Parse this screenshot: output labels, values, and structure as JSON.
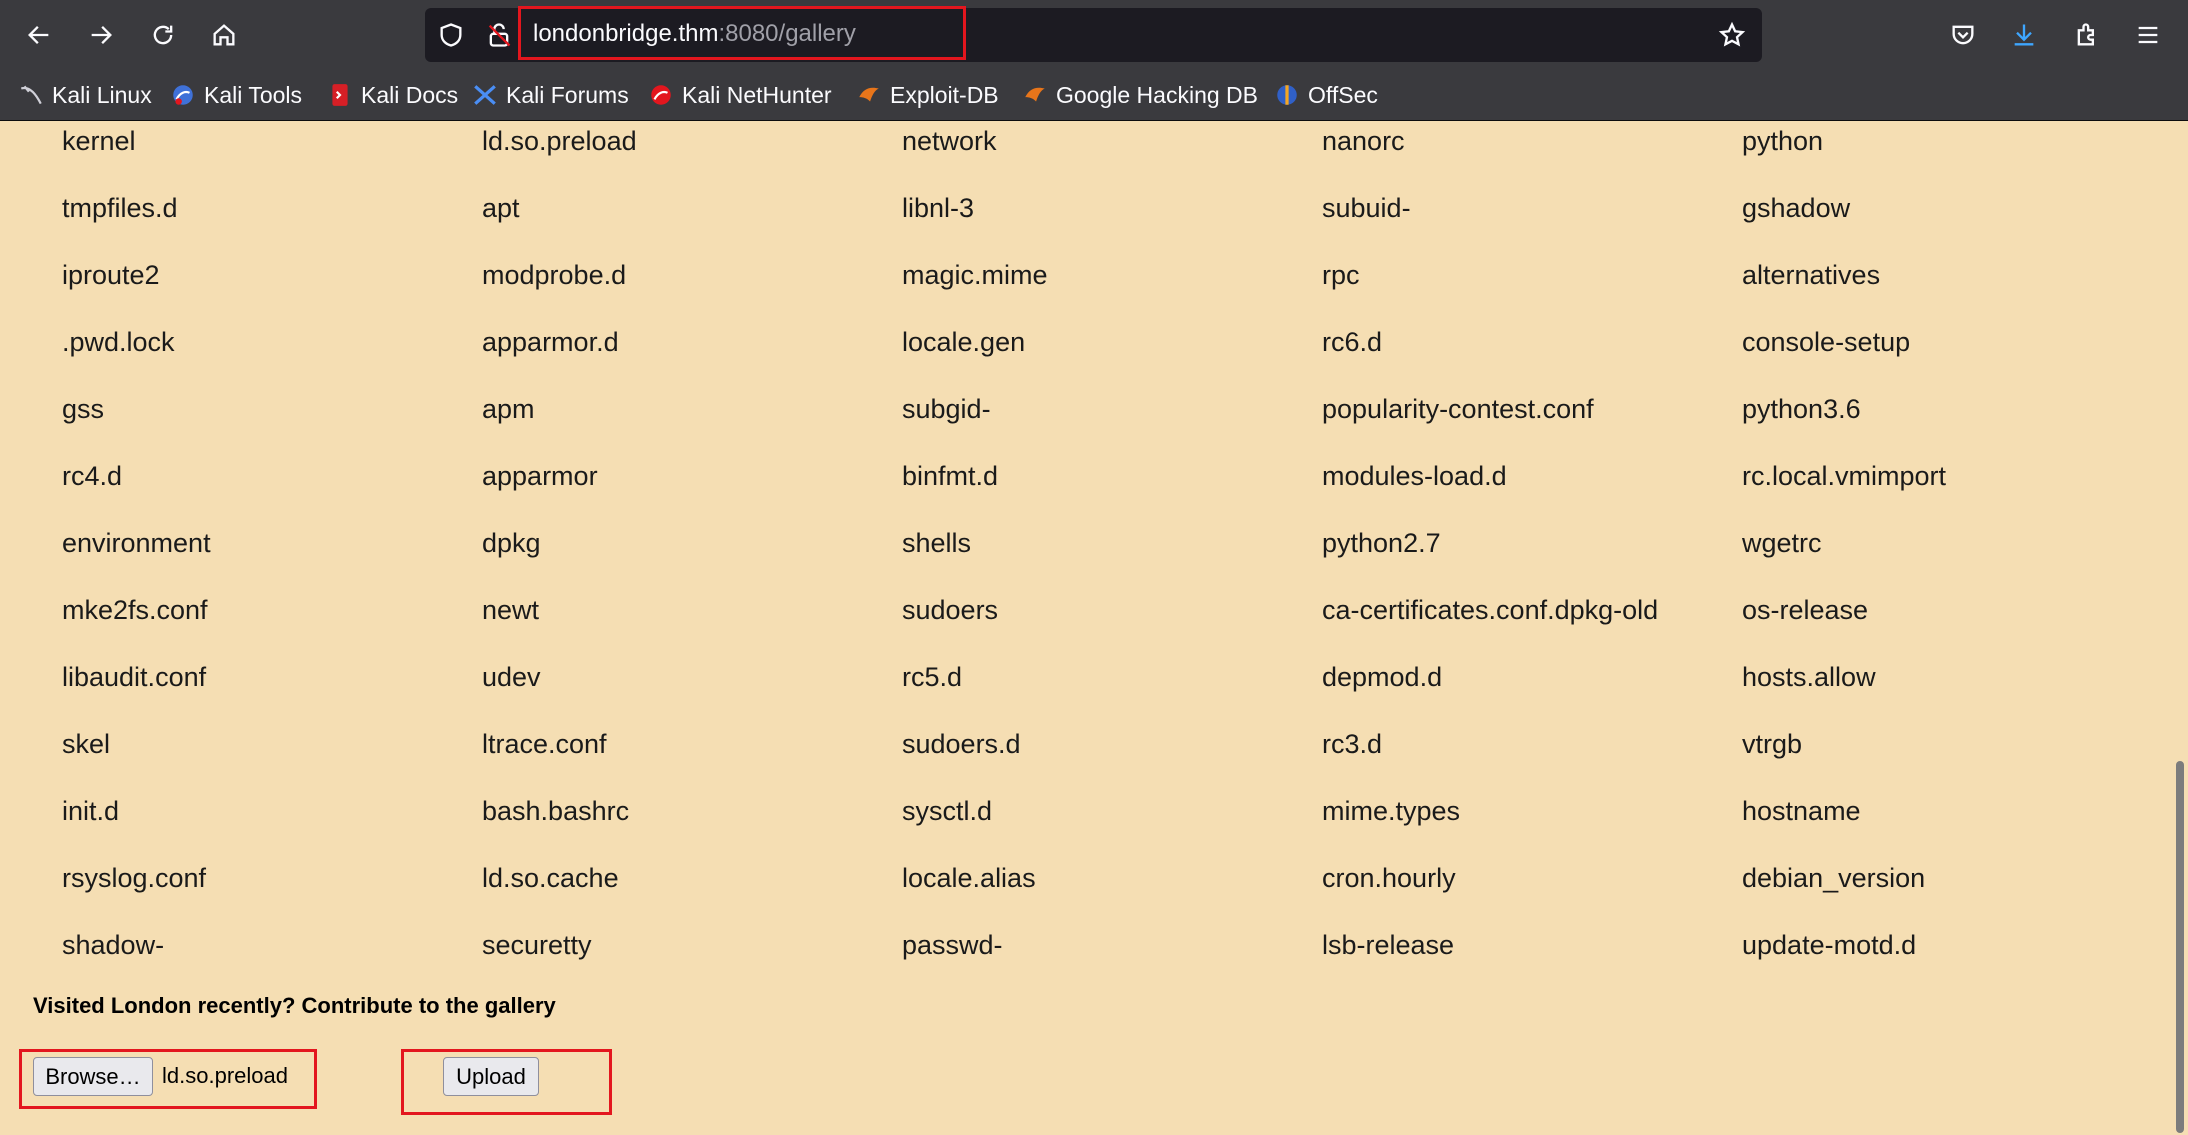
{
  "browser": {
    "url_host": "londonbridge.thm",
    "url_path": ":8080/gallery",
    "bookmarks": [
      {
        "label": "Kali Linux",
        "icon": "kali-dragon-icon"
      },
      {
        "label": "Kali Tools",
        "icon": "kali-tools-icon"
      },
      {
        "label": "Kali Docs",
        "icon": "kali-docs-icon"
      },
      {
        "label": "Kali Forums",
        "icon": "kali-forums-icon"
      },
      {
        "label": "Kali NetHunter",
        "icon": "kali-nethunter-icon"
      },
      {
        "label": "Exploit-DB",
        "icon": "exploit-db-icon"
      },
      {
        "label": "Google Hacking DB",
        "icon": "ghdb-icon"
      },
      {
        "label": "OffSec",
        "icon": "offsec-icon"
      }
    ]
  },
  "gallery": {
    "rows": [
      [
        "kernel",
        "ld.so.preload",
        "network",
        "nanorc",
        "python"
      ],
      [
        "tmpfiles.d",
        "apt",
        "libnl-3",
        "subuid-",
        "gshadow"
      ],
      [
        "iproute2",
        "modprobe.d",
        "magic.mime",
        "rpc",
        "alternatives"
      ],
      [
        ".pwd.lock",
        "apparmor.d",
        "locale.gen",
        "rc6.d",
        "console-setup"
      ],
      [
        "gss",
        "apm",
        "subgid-",
        "popularity-contest.conf",
        "python3.6"
      ],
      [
        "rc4.d",
        "apparmor",
        "binfmt.d",
        "modules-load.d",
        "rc.local.vmimport"
      ],
      [
        "environment",
        "dpkg",
        "shells",
        "python2.7",
        "wgetrc"
      ],
      [
        "mke2fs.conf",
        "newt",
        "sudoers",
        "ca-certificates.conf.dpkg-old",
        "os-release"
      ],
      [
        "libaudit.conf",
        "udev",
        "rc5.d",
        "depmod.d",
        "hosts.allow"
      ],
      [
        "skel",
        "ltrace.conf",
        "sudoers.d",
        "rc3.d",
        "vtrgb"
      ],
      [
        "init.d",
        "bash.bashrc",
        "sysctl.d",
        "mime.types",
        "hostname"
      ],
      [
        "rsyslog.conf",
        "ld.so.cache",
        "locale.alias",
        "cron.hourly",
        "debian_version"
      ],
      [
        "shadow-",
        "securetty",
        "passwd-",
        "lsb-release",
        "update-motd.d"
      ]
    ]
  },
  "upload_form": {
    "prompt": "Visited London recently? Contribute to the gallery",
    "browse_label": "Browse…",
    "selected_file": "ld.so.preload",
    "upload_label": "Upload"
  },
  "colors": {
    "page_bg": "#f5deb3",
    "chrome_bg": "#3a3a3e",
    "highlight": "#e3161e"
  }
}
